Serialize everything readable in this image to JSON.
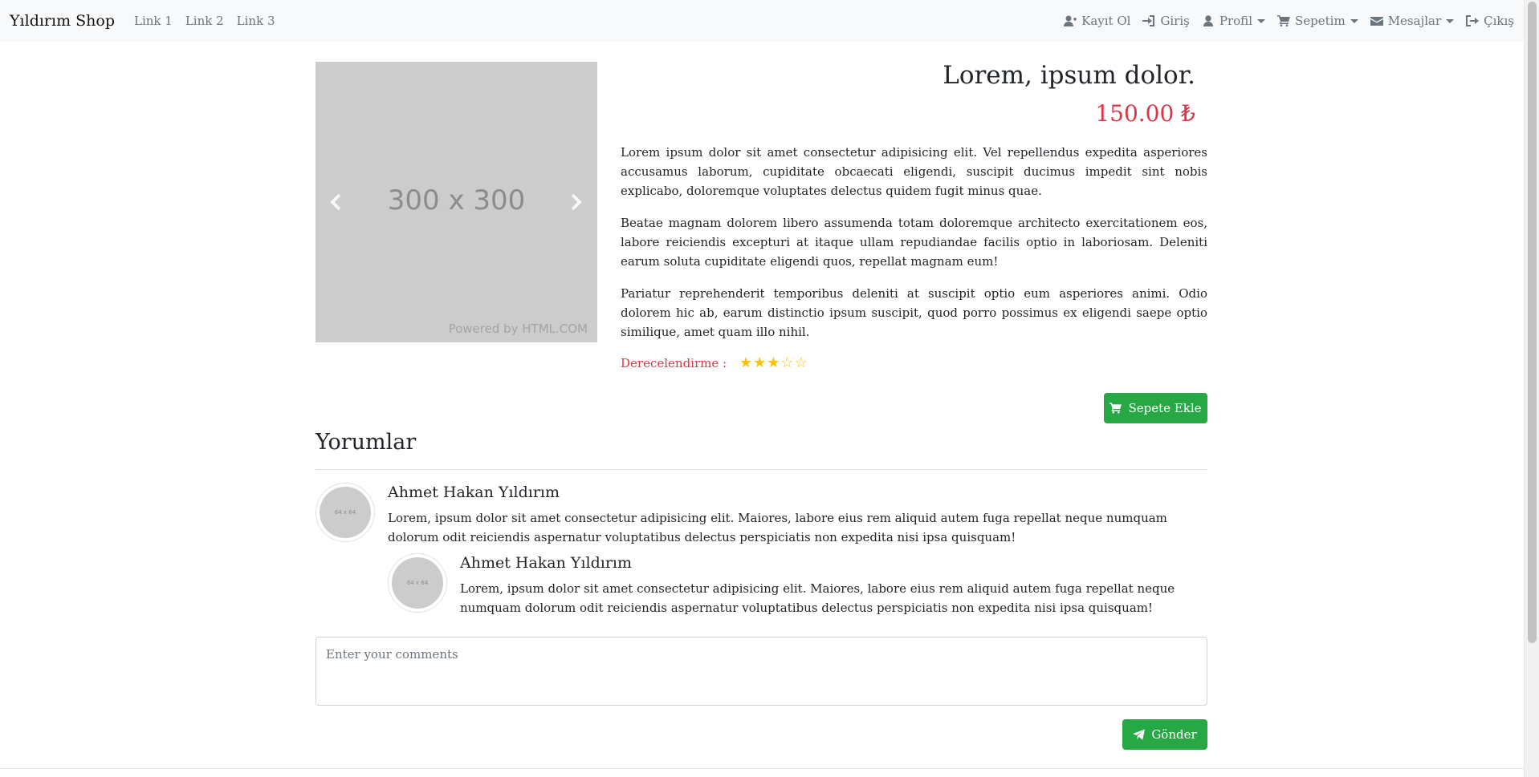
{
  "navbar": {
    "brand": "Yıldırım Shop",
    "links": [
      "Link 1",
      "Link 2",
      "Link 3"
    ],
    "right": {
      "register": "Kayıt Ol",
      "login": "Giriş",
      "profile": "Profil",
      "cart": "Sepetim",
      "messages": "Mesajlar",
      "logout": "Çıkış"
    }
  },
  "carousel": {
    "placeholder": "300 x 300",
    "credit": "Powered by HTML.COM"
  },
  "product": {
    "title": "Lorem, ipsum dolor.",
    "price": "150.00 ₺",
    "paragraphs": [
      "Lorem ipsum dolor sit amet consectetur adipisicing elit. Vel repellendus expedita asperiores accusamus laborum, cupiditate obcaecati eligendi, suscipit ducimus impedit sint nobis explicabo, doloremque voluptates delectus quidem fugit minus quae.",
      "Beatae magnam dolorem libero assumenda totam doloremque architecto exercitationem eos, labore reiciendis excepturi at itaque ullam repudiandae facilis optio in laboriosam. Deleniti earum soluta cupiditate eligendi quos, repellat magnam eum!",
      "Pariatur reprehenderit temporibus deleniti at suscipit optio eum asperiores animi. Odio dolorem hic ab, earum distinctio ipsum suscipit, quod porro possimus ex eligendi saepe optio similique, amet quam illo nihil."
    ],
    "rating_label": "Derecelendirme :",
    "rating": 3,
    "rating_max": 5,
    "add_to_cart": "Sepete Ekle"
  },
  "comments": {
    "title": "Yorumlar",
    "avatar_placeholder": "64 x 64",
    "items": [
      {
        "name": "Ahmet Hakan Yıldırım",
        "text": "Lorem, ipsum dolor sit amet consectetur adipisicing elit. Maiores, labore eius rem aliquid autem fuga repellat neque numquam dolorum odit reiciendis aspernatur voluptatibus delectus perspiciatis non expedita nisi ipsa quisquam!"
      },
      {
        "name": "Ahmet Hakan Yıldırım",
        "text": "Lorem, ipsum dolor sit amet consectetur adipisicing elit. Maiores, labore eius rem aliquid autem fuga repellat neque numquam dolorum odit reiciendis aspernatur voluptatibus delectus perspiciatis non expedita nisi ipsa quisquam!"
      }
    ],
    "input_placeholder": "Enter your comments",
    "send": "Gönder"
  },
  "colors": {
    "accent_green": "#28a745",
    "price_red": "#dc3545",
    "star_yellow": "#ffc107"
  }
}
